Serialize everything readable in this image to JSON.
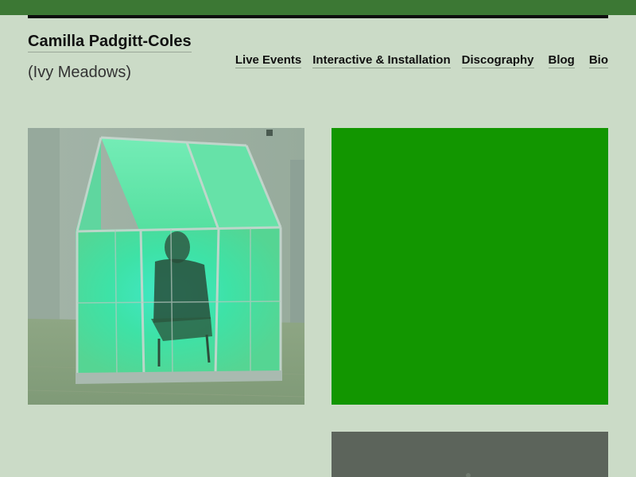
{
  "header": {
    "title": "Camilla Padgitt-Coles",
    "subtitle": "(Ivy Meadows)"
  },
  "nav": {
    "items": [
      {
        "label": "Live Events"
      },
      {
        "label": "Interactive & Installation"
      },
      {
        "label": "Discography"
      },
      {
        "label": "Blog"
      },
      {
        "label": "Bio"
      }
    ]
  },
  "gallery": {
    "tiles": [
      {
        "image": "greenhouse-installation-photo",
        "color": "#8fa897"
      },
      {
        "image": "solid-green-square",
        "color": "#129600"
      },
      {
        "image": "dark-gray-photo",
        "color": "#5a6259"
      }
    ]
  },
  "colors": {
    "background": "#cbdbc7",
    "top_bar": "#3c7834",
    "accent_green": "#129600"
  }
}
